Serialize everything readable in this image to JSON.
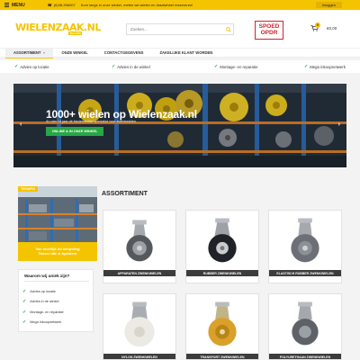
{
  "topbar": {
    "menu_label": "MENU",
    "phone": "(0)38-396007",
    "promo_text": "Kom langs in onze winkel, meten we wielen en draaiwheel reserveren!",
    "login_label": "Inloggen"
  },
  "header": {
    "logo_text": "WIELENZAAK.NL",
    "logo_sub": "TEGAPO",
    "search_placeholder": "Zoeken...",
    "spoed_line1": "SPOED",
    "spoed_line2": "OPDR",
    "cart_count": "0",
    "cart_total": "€0,00"
  },
  "nav": {
    "items": [
      {
        "label": "ASSORTIMENT"
      },
      {
        "label": "ONZE WINKEL"
      },
      {
        "label": "CONTACTGEGEVENS"
      },
      {
        "label": "ZAKELIJKE KLANT WORDEN"
      }
    ]
  },
  "usps": [
    {
      "label": "Advies op locatie"
    },
    {
      "label": "Advies in de winkel"
    },
    {
      "label": "Montage- en reparatie"
    },
    {
      "label": "Mega inkoopnetwerk"
    }
  ],
  "hero": {
    "title": "1000+ wielen op Wielenzaak.nl",
    "subtitle": "Al ruim 14 jaar dé Nederlandse specialist voor zwenkwielen",
    "cta_label": "ONLINE & IN ONZE WINKEL"
  },
  "promo": {
    "ribbon": "TEGAPO",
    "caption_line1": "Van moeilijk tot simpeling",
    "caption_line2": "Tasser tille & Apalders"
  },
  "why": {
    "title": "Waarom wij uniek zijn?",
    "items": [
      {
        "label": "Advies op locatie"
      },
      {
        "label": "Advies in de winkel"
      },
      {
        "label": "Montage- en reparatie"
      },
      {
        "label": "Mega inkoopnetwerk"
      }
    ]
  },
  "assortment": {
    "title": "ASSORTIMENT",
    "products": [
      {
        "label": "APPARATEN ZWENKWIELEN"
      },
      {
        "label": "RUBBER ZWENKWIELEN"
      },
      {
        "label": "ELASTISCH RUBBER ZWENKWIELEN"
      },
      {
        "label": "NYLON ZWENKWIELEN"
      },
      {
        "label": "TRANSPORT ZWENKWIELEN"
      },
      {
        "label": "POLYURETHAAN ZWENKWIELEN"
      }
    ]
  },
  "colors": {
    "brand_yellow": "#f5c400",
    "cta_green": "#27a844",
    "spoed_red": "#d2232a",
    "label_dark": "#3c3c3c"
  },
  "icons": [
    "hamburger-icon",
    "phone-icon",
    "search-icon",
    "cart-icon",
    "check-icon",
    "chevron-left-icon",
    "chevron-right-icon"
  ]
}
